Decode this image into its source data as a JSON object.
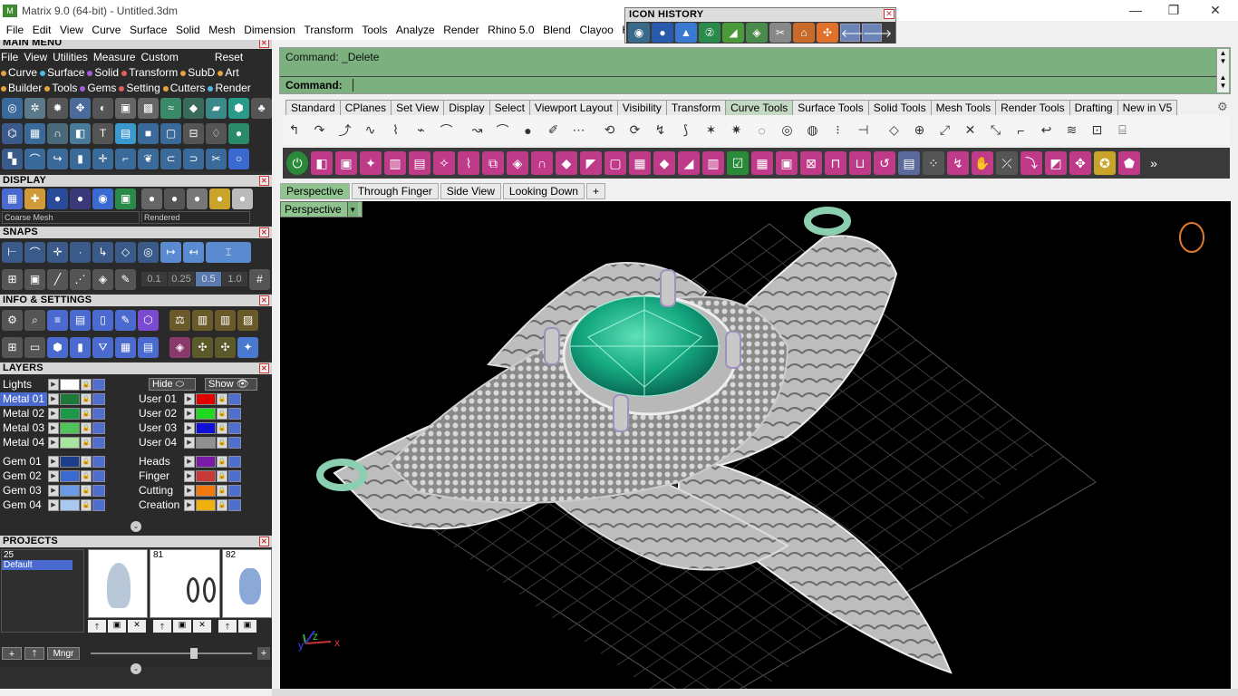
{
  "window": {
    "title": "Matrix 9.0 (64-bit) - Untitled.3dm",
    "controls": {
      "minimize": "—",
      "restore": "❐",
      "close": "✕"
    }
  },
  "menubar": [
    "File",
    "Edit",
    "View",
    "Curve",
    "Surface",
    "Solid",
    "Mesh",
    "Dimension",
    "Transform",
    "Tools",
    "Analyze",
    "Render",
    "Rhino 5.0",
    "Blend",
    "Clayoo",
    "Help"
  ],
  "icon_history": {
    "title": "ICON HISTORY",
    "back": "🡐",
    "forward": "🡒"
  },
  "main_menu": {
    "title": "MAIN MENU",
    "row1": [
      "File",
      "View",
      "Utilities",
      "Measure",
      "Custom"
    ],
    "reset": "Reset",
    "row2": [
      {
        "label": "Curve",
        "color": "#e6a23c"
      },
      {
        "label": "Surface",
        "color": "#4fb8e6"
      },
      {
        "label": "Solid",
        "color": "#a55fd8"
      },
      {
        "label": "Transform",
        "color": "#e0605b"
      },
      {
        "label": "SubD",
        "color": "#e6a23c"
      },
      {
        "label": "Art",
        "color": "#e6a23c"
      }
    ],
    "row3": [
      {
        "label": "Builder",
        "color": "#e6a23c"
      },
      {
        "label": "Tools",
        "color": "#e6a23c"
      },
      {
        "label": "Gems",
        "color": "#a55fd8"
      },
      {
        "label": "Setting",
        "color": "#e0605b"
      },
      {
        "label": "Cutters",
        "color": "#e6a23c"
      },
      {
        "label": "Render",
        "color": "#4fb8e6"
      }
    ]
  },
  "display": {
    "title": "DISPLAY",
    "mesh_select": "Coarse Mesh",
    "render_select": "Rendered"
  },
  "snaps": {
    "title": "SNAPS",
    "values": [
      "0.1",
      "0.25",
      "0.5",
      "1.0"
    ]
  },
  "info_settings": {
    "title": "INFO & SETTINGS"
  },
  "layers": {
    "title": "LAYERS",
    "lights": "Lights",
    "hide": "Hide",
    "show": "Show",
    "left": [
      {
        "name": "Metal 01",
        "color": "#1e7a3a",
        "selected": true
      },
      {
        "name": "Metal 02",
        "color": "#1a9a48"
      },
      {
        "name": "Metal 03",
        "color": "#4ec458"
      },
      {
        "name": "Metal 04",
        "color": "#a8e6a0"
      },
      {
        "name": "Gem 01",
        "color": "#1e3c8c"
      },
      {
        "name": "Gem 02",
        "color": "#3a6ad0"
      },
      {
        "name": "Gem 03",
        "color": "#6a9ae6"
      },
      {
        "name": "Gem 04",
        "color": "#a8c8f0"
      }
    ],
    "right": [
      {
        "name": "User 01",
        "color": "#e00000"
      },
      {
        "name": "User 02",
        "color": "#20d820"
      },
      {
        "name": "User 03",
        "color": "#1010d8"
      },
      {
        "name": "User 04",
        "color": "#909090"
      },
      {
        "name": "Heads",
        "color": "#7a1aa8"
      },
      {
        "name": "Finger",
        "color": "#c83a3a"
      },
      {
        "name": "Cutting",
        "color": "#f07a10"
      },
      {
        "name": "Creation",
        "color": "#f0b010"
      }
    ]
  },
  "projects": {
    "title": "PROJECTS",
    "count": "25",
    "items": [
      "Default"
    ],
    "thumbs": [
      {
        "label": ""
      },
      {
        "label": "81"
      },
      {
        "label": "82"
      }
    ],
    "buttons": {
      "add": "+",
      "up": "🡑",
      "manager": "Mngr",
      "plus": "+"
    }
  },
  "command": {
    "history": "Command: _Delete",
    "prompt": "Command:"
  },
  "toolbar_tabs": [
    {
      "label": "Standard"
    },
    {
      "label": "CPlanes"
    },
    {
      "label": "Set View"
    },
    {
      "label": "Display"
    },
    {
      "label": "Select"
    },
    {
      "label": "Viewport Layout"
    },
    {
      "label": "Visibility"
    },
    {
      "label": "Transform"
    },
    {
      "label": "Curve Tools",
      "active": true
    },
    {
      "label": "Surface Tools"
    },
    {
      "label": "Solid Tools"
    },
    {
      "label": "Mesh Tools"
    },
    {
      "label": "Render Tools"
    },
    {
      "label": "Drafting"
    },
    {
      "label": "New in V5"
    }
  ],
  "viewport_tabs": [
    {
      "label": "Perspective",
      "active": true
    },
    {
      "label": "Through Finger"
    },
    {
      "label": "Side View"
    },
    {
      "label": "Looking Down"
    },
    {
      "label": "+"
    }
  ],
  "viewport": {
    "label": "Perspective",
    "axes": {
      "x": "x",
      "y": "y",
      "z": "z"
    }
  },
  "colors": {
    "accent_green": "#8fc48f",
    "cmd_bg": "#7cb07f",
    "panel_bg": "#2f2f2f"
  }
}
